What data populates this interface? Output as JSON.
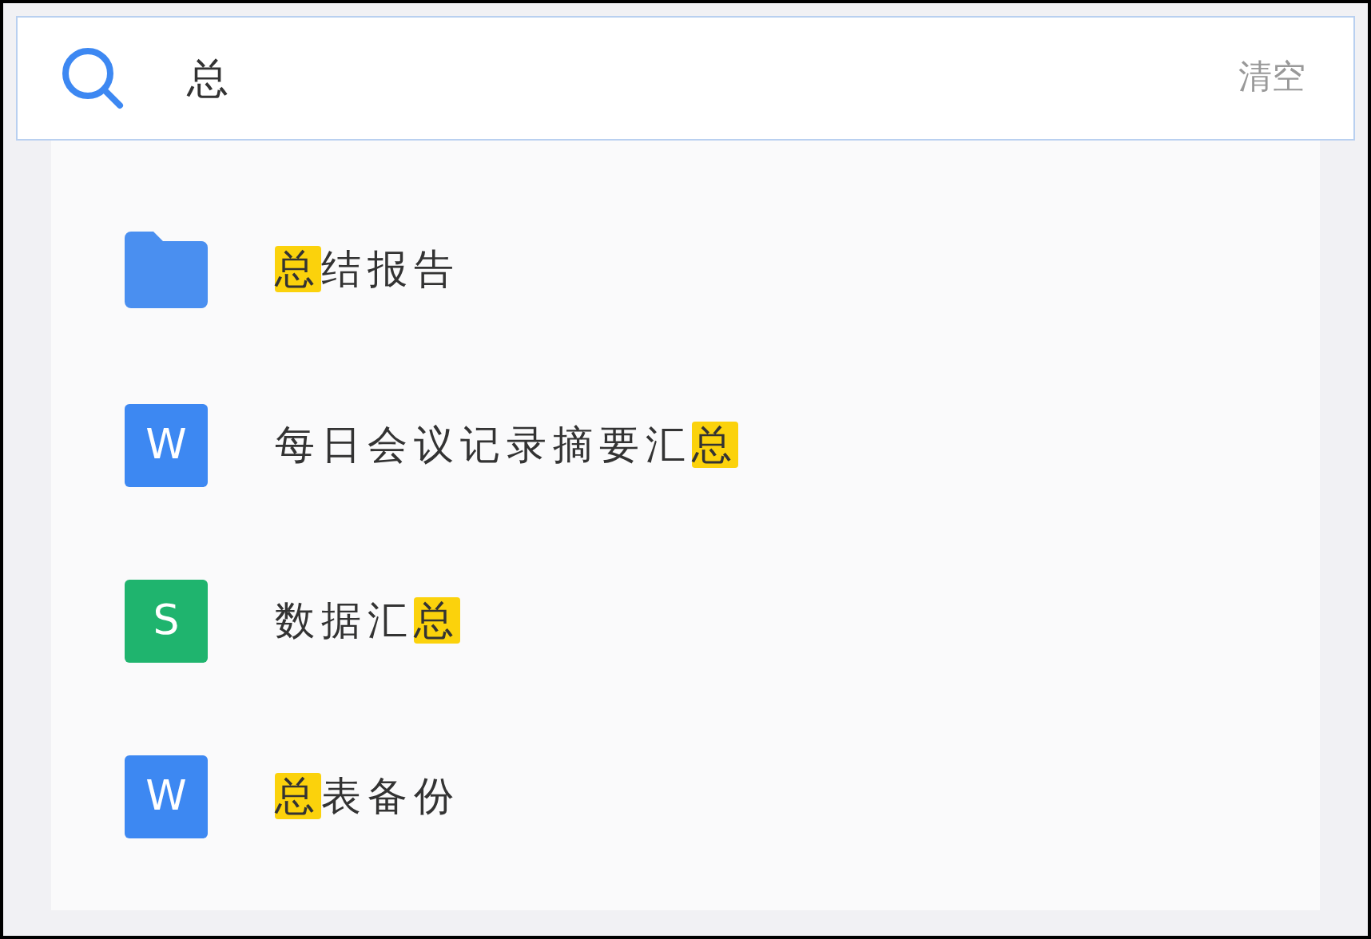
{
  "search": {
    "value": "总",
    "clear_label": "清空"
  },
  "results": [
    {
      "kind": "folder",
      "segments": [
        {
          "text": "总",
          "highlight": true
        },
        {
          "text": "结报告",
          "highlight": false
        }
      ]
    },
    {
      "kind": "doc",
      "badge": "W",
      "color": "#3d88f2",
      "segments": [
        {
          "text": "每日会议记录摘要汇",
          "highlight": false
        },
        {
          "text": "总",
          "highlight": true
        }
      ]
    },
    {
      "kind": "doc",
      "badge": "S",
      "color": "#1fb46e",
      "segments": [
        {
          "text": "数据汇",
          "highlight": false
        },
        {
          "text": "总",
          "highlight": true
        }
      ]
    },
    {
      "kind": "doc",
      "badge": "W",
      "color": "#3d88f2",
      "segments": [
        {
          "text": "总",
          "highlight": true
        },
        {
          "text": "表备份",
          "highlight": false
        }
      ]
    }
  ]
}
